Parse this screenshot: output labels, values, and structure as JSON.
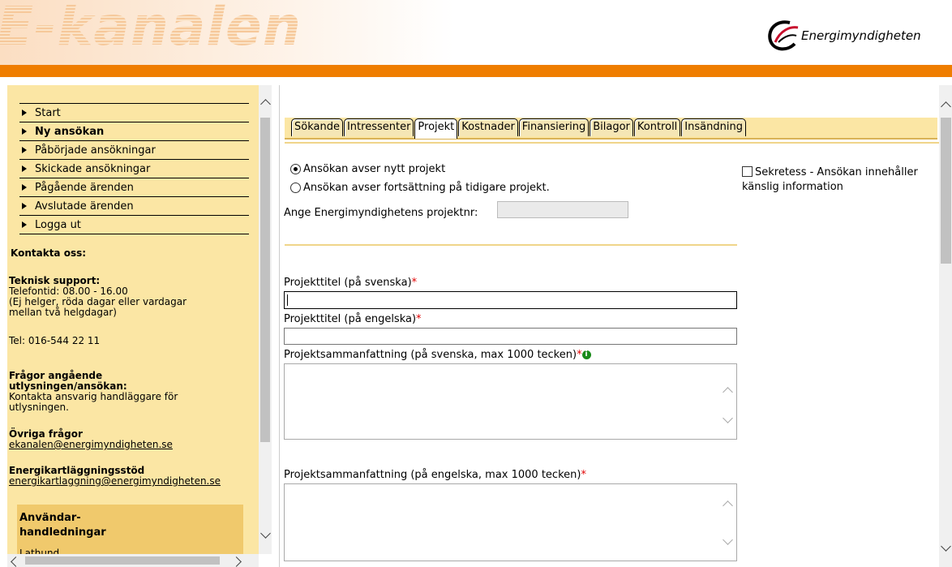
{
  "header": {
    "wordmark": "E-kanalen",
    "logo_text": "Energimyndigheten"
  },
  "sidebar": {
    "nav": [
      {
        "label": "Start",
        "bold": false
      },
      {
        "label": "Ny ansökan",
        "bold": true
      },
      {
        "label": "Påbörjade ansökningar",
        "bold": false
      },
      {
        "label": "Skickade ansökningar",
        "bold": false
      },
      {
        "label": "Pågående ärenden",
        "bold": false
      },
      {
        "label": "Avslutade ärenden",
        "bold": false
      },
      {
        "label": "Logga ut",
        "bold": false
      }
    ],
    "contact_heading": "Kontakta oss:",
    "tech_support_heading": "Teknisk support:",
    "tech_support_hours": "Telefontid: 08.00 - 16.00",
    "tech_support_note_1": "(Ej helger, röda dagar eller vardagar",
    "tech_support_note_2": "mellan två helgdagar)",
    "phone": "Tel: 016-544 22 11",
    "call_questions_heading_1": "Frågor angående",
    "call_questions_heading_2": "utlysningen/ansökan:",
    "call_questions_text_1": "Kontakta ansvarig handläggare för",
    "call_questions_text_2": "utlysningen.",
    "other_questions_heading": "Övriga frågor",
    "other_questions_email": "ekanalen@energimyndigheten.se",
    "energy_audit_heading": "Energikartläggningsstöd",
    "energy_audit_email": "energikartlaggning@energimyndigheten.se",
    "guides_heading_1": "Användar-",
    "guides_heading_2": "handledningar",
    "guides_link": "Lathund"
  },
  "tabs": [
    {
      "label": "Sökande",
      "active": false
    },
    {
      "label": "Intressenter",
      "active": false
    },
    {
      "label": "Projekt",
      "active": true
    },
    {
      "label": "Kostnader",
      "active": false
    },
    {
      "label": "Finansiering",
      "active": false
    },
    {
      "label": "Bilagor",
      "active": false
    },
    {
      "label": "Kontroll",
      "active": false
    },
    {
      "label": "Insändning",
      "active": false
    }
  ],
  "form": {
    "radio_new": "Ansökan avser nytt projekt",
    "radio_new_selected": true,
    "radio_continuation": "Ansökan avser fortsättning på tidigare projekt.",
    "radio_continuation_selected": false,
    "project_nr_label": "Ange Energimyndighetens projektnr:",
    "project_nr_value": "",
    "confidential_label_1": "Sekretess - Ansökan innehåller",
    "confidential_label_2": "känslig information",
    "confidential_checked": false,
    "title_sv_label": "Projekttitel (på svenska)",
    "title_sv_value": "",
    "title_en_label": "Projekttitel (på engelska)",
    "title_en_value": "",
    "summary_sv_label": "Projektsammanfattning (på svenska, max 1000 tecken)",
    "summary_sv_value": "",
    "summary_en_label": "Projektsammanfattning (på engelska, max 1000 tecken)",
    "summary_en_value": "",
    "required_mark": "*",
    "info_icon_glyph": "i"
  },
  "colors": {
    "orange": "#ef7d00",
    "sidebar_bg": "#fbe6a4",
    "guides_bg": "#f0c96c",
    "tab_bar_bg": "#fbe6a4",
    "required": "#e10000",
    "info_green": "#1a8a1a"
  }
}
